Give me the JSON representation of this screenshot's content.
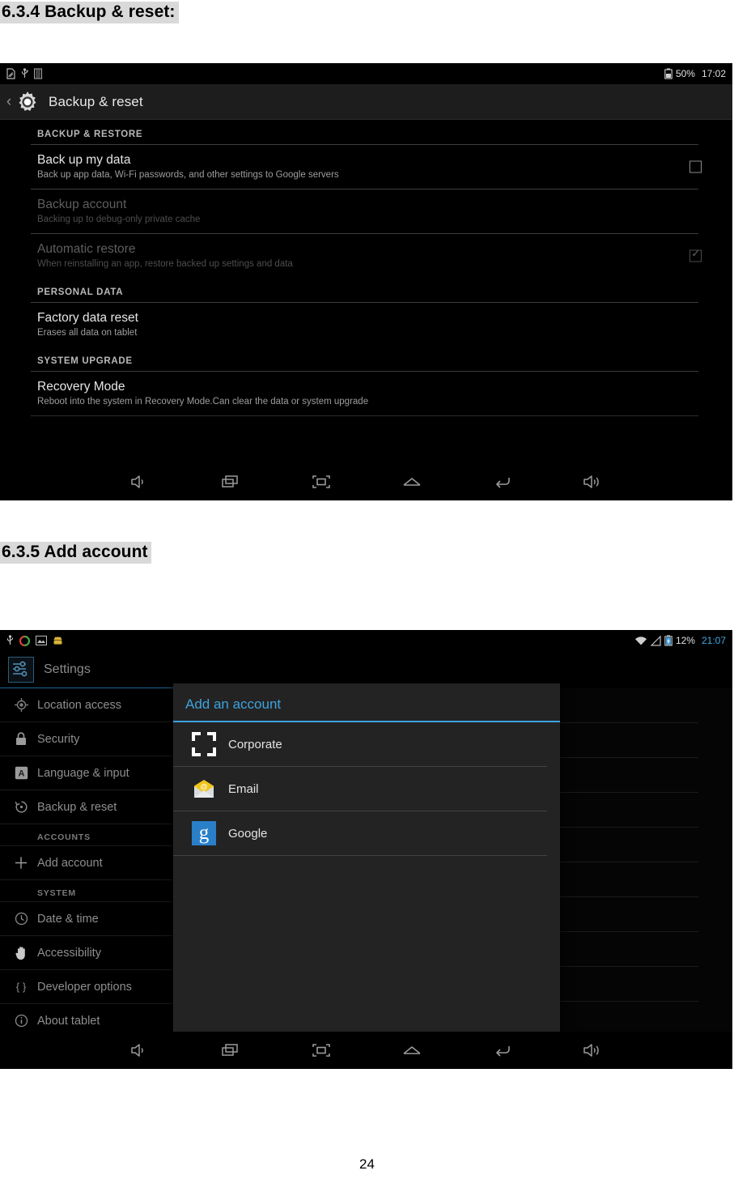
{
  "document": {
    "heading_634": "6.3.4 Backup & reset:",
    "heading_635": "6.3.5 Add account",
    "page_number": "24"
  },
  "screenshot_backup": {
    "status_bar": {
      "left_icons": [
        "sd-card-icon",
        "usb-icon",
        "sim-card-icon"
      ],
      "battery_icon": "battery-icon",
      "battery_percent": "50%",
      "clock": "17:02"
    },
    "action_bar": {
      "back_icon": "back-chevron-icon",
      "app_icon": "settings-gear-icon",
      "title": "Backup & reset"
    },
    "sections": [
      {
        "header": "BACKUP & RESTORE",
        "rows": [
          {
            "title": "Back up my data",
            "summary": "Back up app data, Wi-Fi passwords, and other settings to Google servers",
            "checkbox": "unchecked",
            "enabled": true
          },
          {
            "title": "Backup account",
            "summary": "Backing up to debug-only private cache",
            "checkbox": "none",
            "enabled": false
          },
          {
            "title": "Automatic restore",
            "summary": "When reinstalling an app, restore backed up settings and data",
            "checkbox": "checked",
            "enabled": false
          }
        ]
      },
      {
        "header": "PERSONAL DATA",
        "rows": [
          {
            "title": "Factory data reset",
            "summary": "Erases all data on tablet",
            "checkbox": "none",
            "enabled": true
          }
        ]
      },
      {
        "header": "SYSTEM UPGRADE",
        "rows": [
          {
            "title": "Recovery Mode",
            "summary": "Reboot into the system in Recovery Mode.Can clear the data or system upgrade",
            "checkbox": "none",
            "enabled": true
          }
        ]
      }
    ],
    "nav_bar": [
      "volume-down-icon",
      "recent-apps-icon",
      "screenshot-icon",
      "home-icon",
      "back-icon",
      "volume-up-icon"
    ]
  },
  "screenshot_add_account": {
    "status_bar": {
      "left_icons": [
        "usb-icon",
        "sync-icon",
        "screenshot-icon",
        "android-icon"
      ],
      "right_icons": [
        "wifi-icon",
        "signal-icon",
        "battery-charging-icon"
      ],
      "battery_percent": "12%",
      "clock": "21:07"
    },
    "header": {
      "icon": "settings-sliders-icon",
      "title": "Settings"
    },
    "sidebar": [
      {
        "type": "item",
        "icon": "location-icon",
        "label": "Location access"
      },
      {
        "type": "item",
        "icon": "lock-icon",
        "label": "Security"
      },
      {
        "type": "item",
        "icon": "language-icon",
        "label": "Language & input"
      },
      {
        "type": "item",
        "icon": "backup-restore-icon",
        "label": "Backup & reset"
      },
      {
        "type": "header",
        "label": "ACCOUNTS"
      },
      {
        "type": "item",
        "icon": "plus-icon",
        "label": "Add account"
      },
      {
        "type": "header",
        "label": "SYSTEM"
      },
      {
        "type": "item",
        "icon": "clock-icon",
        "label": "Date & time"
      },
      {
        "type": "item",
        "icon": "hand-icon",
        "label": "Accessibility"
      },
      {
        "type": "item",
        "icon": "braces-icon",
        "label": "Developer options"
      },
      {
        "type": "item",
        "icon": "info-icon",
        "label": "About tablet"
      }
    ],
    "dialog": {
      "title": "Add an account",
      "accent_color": "#3ea2dd",
      "options": [
        {
          "icon": "corporate-icon",
          "label": "Corporate"
        },
        {
          "icon": "email-icon",
          "label": "Email"
        },
        {
          "icon": "google-icon",
          "label": "Google"
        }
      ]
    },
    "nav_bar": [
      "volume-down-icon",
      "recent-apps-icon",
      "screenshot-icon",
      "home-icon",
      "back-icon",
      "volume-up-icon"
    ]
  }
}
